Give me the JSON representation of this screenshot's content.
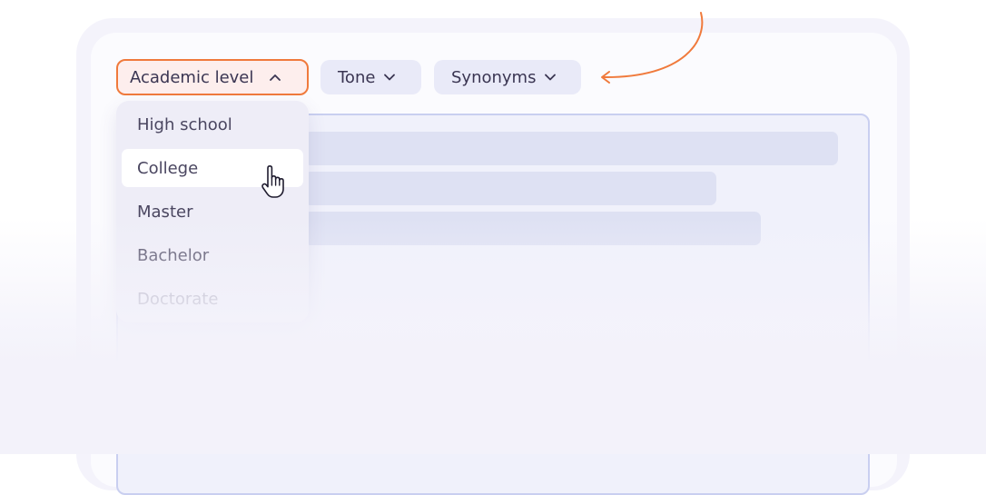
{
  "toolbar": {
    "academic_level_label": "Academic level",
    "tone_label": "Tone",
    "synonyms_label": "Synonyms"
  },
  "dropdown": {
    "items": [
      {
        "label": "High school",
        "state": "normal"
      },
      {
        "label": "College",
        "state": "hovered"
      },
      {
        "label": "Master",
        "state": "normal"
      },
      {
        "label": "Bachelor",
        "state": "normal"
      },
      {
        "label": "Doctorate",
        "state": "disabled"
      }
    ]
  },
  "icons": {
    "academic_level_chevron": "chevron-up-icon",
    "tone_chevron": "chevron-down-icon",
    "synonyms_chevron": "chevron-down-icon",
    "pointer": "hand-pointer-icon",
    "annotation_arrow": "curved-arrow-icon"
  },
  "colors": {
    "accent": "#f07a3c",
    "chip_background": "#e9eaf8",
    "active_chip_background": "#fdeeed",
    "text": "#3a3552"
  }
}
